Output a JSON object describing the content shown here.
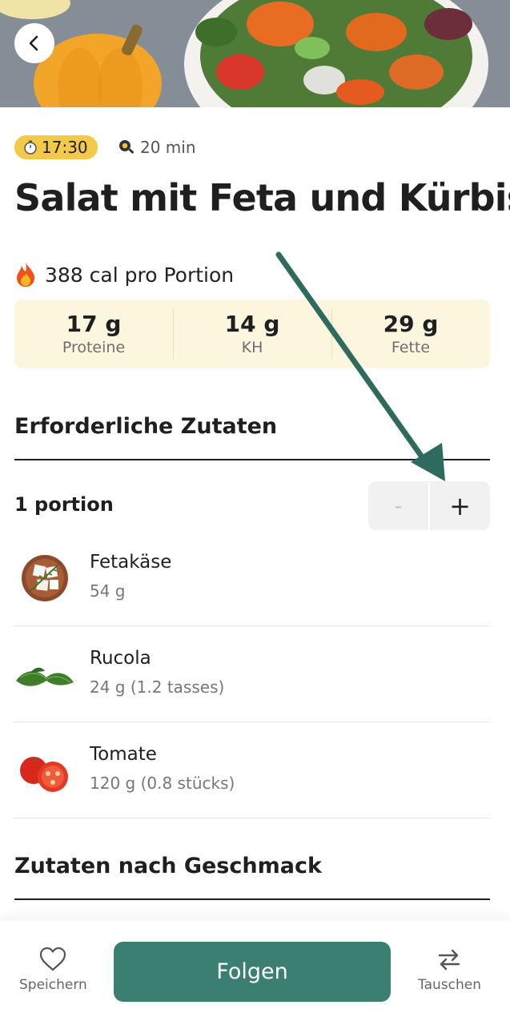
{
  "recipe": {
    "time_badge": "17:30",
    "duration": "20 min",
    "title": "Salat mit Feta und Kürbis",
    "calories": "388 cal pro Portion",
    "macros": [
      {
        "value": "17 g",
        "label": "Proteine"
      },
      {
        "value": "14 g",
        "label": "KH"
      },
      {
        "value": "29 g",
        "label": "Fette"
      }
    ]
  },
  "ingredients_section": {
    "title": "Erforderliche Zutaten",
    "portion_label": "1 portion",
    "minus_label": "-",
    "plus_label": "+",
    "items": [
      {
        "name": "Fetakäse",
        "amount": "54 g",
        "icon": "feta-cheese-icon"
      },
      {
        "name": "Rucola",
        "amount": "24 g (1.2 tasses)",
        "icon": "arugula-icon"
      },
      {
        "name": "Tomate",
        "amount": "120 g (0.8 stücks)",
        "icon": "tomato-icon"
      }
    ]
  },
  "taste_section": {
    "title": "Zutaten nach Geschmack"
  },
  "bottom_bar": {
    "save_label": "Speichern",
    "follow_label": "Folgen",
    "swap_label": "Tauschen"
  },
  "colors": {
    "accent": "#3b7f72",
    "time_badge": "#f3c94a",
    "macros_bg": "#fdf6de",
    "annotation_arrow": "#2e6b5e"
  }
}
